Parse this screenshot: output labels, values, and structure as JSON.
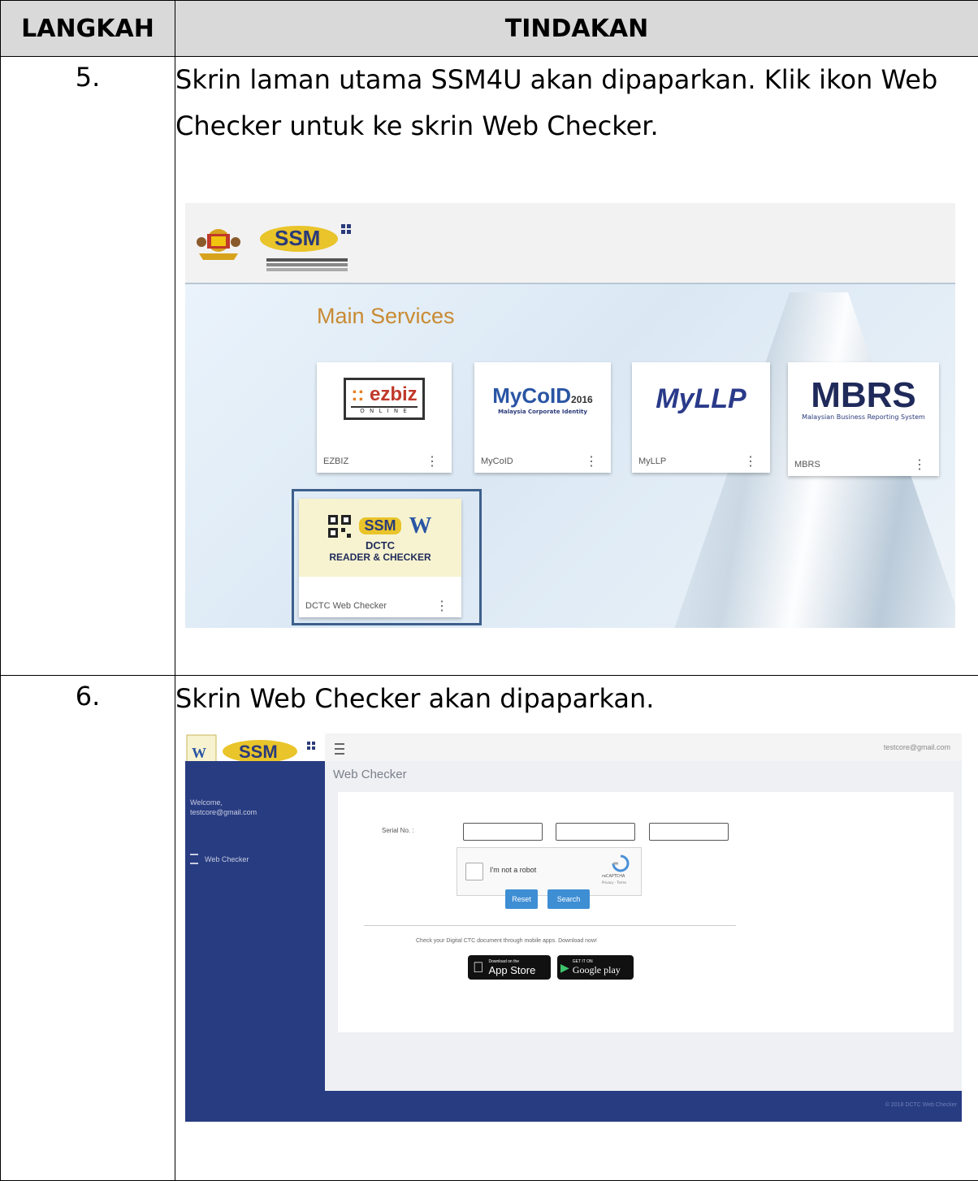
{
  "table": {
    "header_step": "LANGKAH",
    "header_action": "TINDAKAN"
  },
  "rows": [
    {
      "step": "5.",
      "text": "Skrin laman utama SSM4U akan dipaparkan. Klik ikon Web Checker untuk ke skrin Web Checker."
    },
    {
      "step": "6.",
      "text": "Skrin Web Checker akan dipaparkan."
    }
  ],
  "screenshot1": {
    "section_title": "Main Services",
    "services": [
      {
        "label": "EZBIZ",
        "logo_text": "ezbiz",
        "logo_sub": "O N L I N E"
      },
      {
        "label": "MyCoID",
        "logo_text": "MyCoID",
        "logo_year": "2016",
        "logo_sub": "Malaysia Corporate Identity"
      },
      {
        "label": "MyLLP",
        "logo_text": "MyLLP"
      },
      {
        "label": "MBRS",
        "logo_text": "MBRS",
        "logo_sub": "Malaysian Business Reporting System"
      },
      {
        "label": "DCTC Web Checker",
        "logo_text": "DCTC",
        "logo_sub": "READER & CHECKER"
      }
    ],
    "menu_glyph": "⋮",
    "highlight_color": "#3d5f8c",
    "accent_color": "#c98a32"
  },
  "screenshot2": {
    "page_title": "Web Checker",
    "user_email": "testcore@gmail.com",
    "welcome_label": "Welcome,",
    "welcome_email": "testcore@gmail.com",
    "nav_item": "Web Checker",
    "serial_label": "Serial No. :",
    "captcha_label": "I'm not a robot",
    "captcha_brand": "reCAPTCHA",
    "captcha_terms": "Privacy - Terms",
    "reset_label": "Reset",
    "search_label": "Search",
    "promo_text": "Check your Digital CTC document through mobile apps. Download now!",
    "appstore_small": "Download on the",
    "appstore_big": "App Store",
    "googleplay_small": "GET IT ON",
    "googleplay_big": "Google play",
    "footer_text": "© 2018 DCTC Web Checker",
    "sidebar_color": "#283c82",
    "button_color": "#3e8ed4"
  }
}
